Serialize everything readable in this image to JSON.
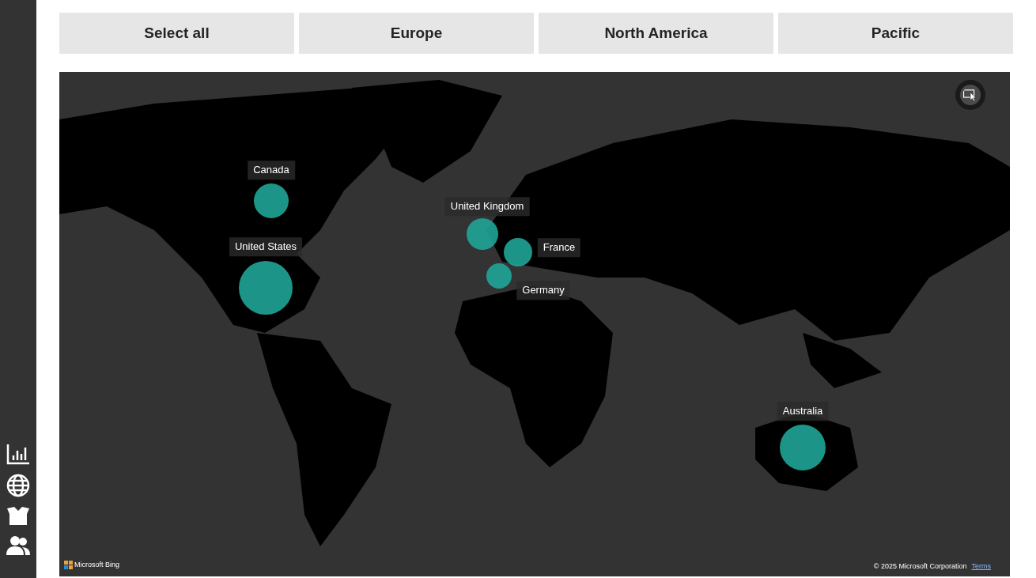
{
  "filters": [
    {
      "label": "Select all",
      "selected": false
    },
    {
      "label": "Europe",
      "selected": false
    },
    {
      "label": "North America",
      "selected": false
    },
    {
      "label": "Pacific",
      "selected": false
    }
  ],
  "map": {
    "bubbles": [
      {
        "label": "Canada"
      },
      {
        "label": "United States"
      },
      {
        "label": "United Kingdom"
      },
      {
        "label": "France"
      },
      {
        "label": "Germany"
      },
      {
        "label": "Australia"
      }
    ],
    "provider": "Microsoft Bing",
    "copyright": "© 2025 Microsoft Corporation",
    "terms": "Terms"
  }
}
